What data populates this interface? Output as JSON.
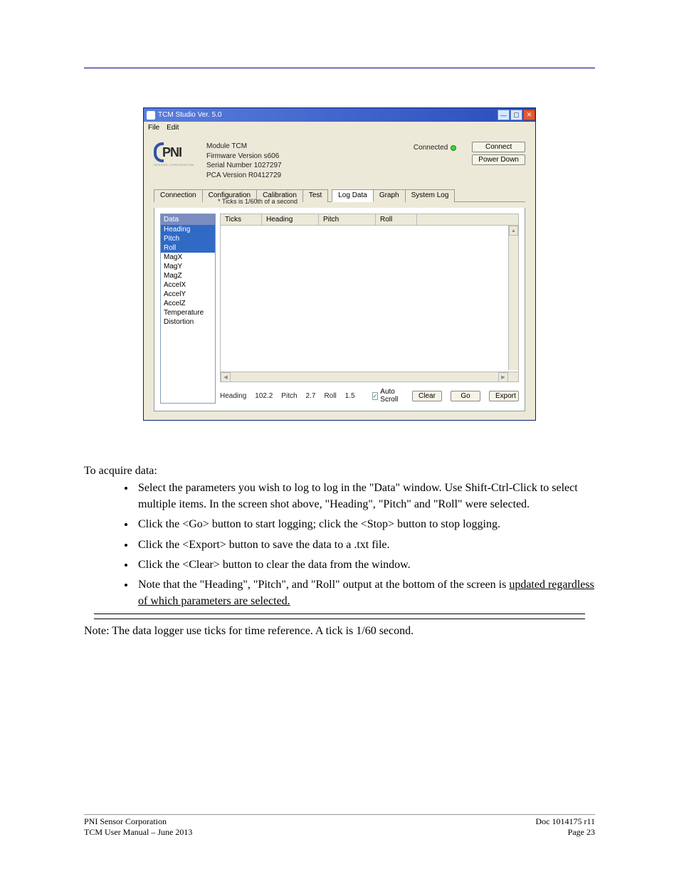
{
  "window": {
    "title": "TCM Studio Ver. 5.0",
    "menus": [
      "File",
      "Edit"
    ]
  },
  "logo": {
    "name": "PNI",
    "tagline": "SENSOR CORPORATION"
  },
  "module_info": {
    "l1": "Module TCM",
    "l2": "Firmware Version s606",
    "l3": "Serial Number 1027297",
    "l4": "PCA Version R0412729"
  },
  "connection": {
    "status": "Connected",
    "connect_btn": "Connect",
    "powerdown_btn": "Power Down"
  },
  "tabs": [
    "Connection",
    "Configuration",
    "Calibration",
    "Test"
  ],
  "tabs2": [
    "Log Data",
    "Graph",
    "System Log"
  ],
  "ticks_note": "* Ticks is 1/60th of a second",
  "data_panel": {
    "header": "Data",
    "items": [
      "Heading",
      "Pitch",
      "Roll",
      "MagX",
      "MagY",
      "MagZ",
      "AccelX",
      "AccelY",
      "AccelZ",
      "Temperature",
      "Distortion"
    ],
    "selected": [
      0,
      1,
      2
    ]
  },
  "log_cols": [
    "Ticks",
    "Heading",
    "Pitch",
    "Roll"
  ],
  "status": {
    "heading_lbl": "Heading",
    "heading_val": "102.2",
    "pitch_lbl": "Pitch",
    "pitch_val": "2.7",
    "roll_lbl": "Roll",
    "roll_val": "1.5",
    "autoscroll": "Auto Scroll",
    "clear": "Clear",
    "go": "Go",
    "export": "Export"
  },
  "body": {
    "p_intro": "To acquire data:",
    "li1_a": "Select the parameters you wish to log",
    "li1_b": " to log in the \"Data\" window.",
    "li1_c": " Use Shift-Ctrl-Click to select multiple items.  ",
    "li1_d": "In the screen shot above, \"Heading\", \"",
    "li1_e": "Pitch",
    "li1_f": "\" and ",
    "li1_g": "\"Roll\"",
    "li1_h": " were selected.",
    "li2": "Click the <Go> button to start logging; click the <Stop> button to stop logging.",
    "li3": "Click the <Export> button to save the data to a .txt file.",
    "li4": "Click the <Clear> button to clear the data from the window.",
    "li5_a": "Note that the \"Heading\", \"Pitch\", and \"Roll\" ",
    "li5_b": "output at the bottom of the screen is ",
    "li5_c": "updated regardless of which parameters are selected.",
    "p_note": "Note:  The data logger use ticks for time reference.  A tick is 1/60 second."
  },
  "footer": {
    "left": "PNI Sensor Corporation",
    "right": "Doc 1014175 r11",
    "center": "TCM User Manual – June 2013",
    "page": "Page 23"
  }
}
